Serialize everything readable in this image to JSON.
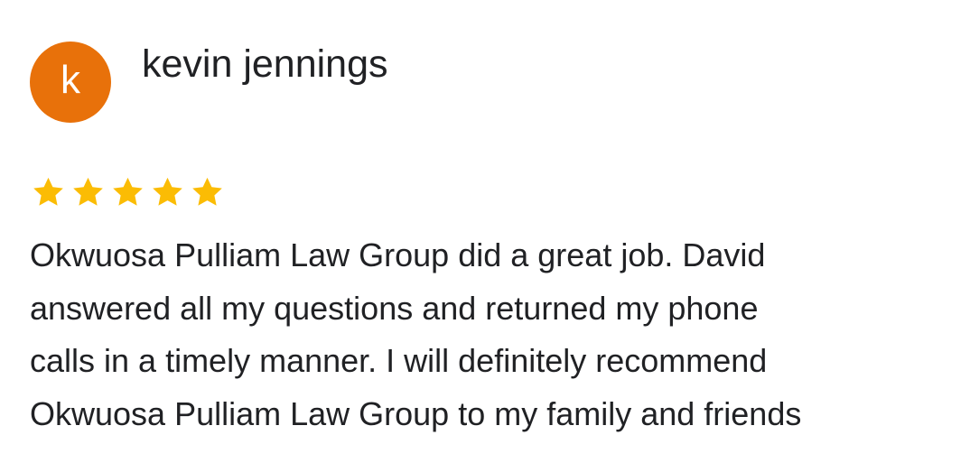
{
  "review": {
    "avatar_letter": "k",
    "reviewer_name": "kevin jennings",
    "rating": 5,
    "rating_max": 5,
    "text": "Okwuosa Pulliam  Law Group did a great job. David\nanswered all my questions and returned my phone\ncalls in a timely manner. I will definitely recommend\nOkwuosa Pulliam Law Group to my family and friends"
  },
  "colors": {
    "avatar_bg": "#E8710A",
    "star_filled": "#FBBC04",
    "star_empty": "#DADCE0",
    "text": "#202124"
  }
}
